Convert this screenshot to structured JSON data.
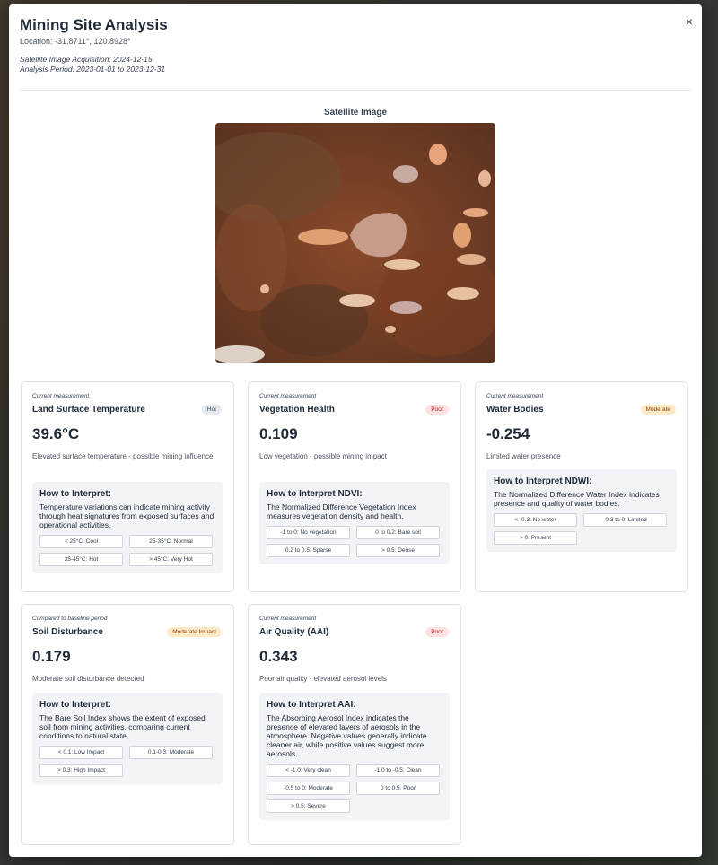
{
  "modal": {
    "title": "Mining Site Analysis",
    "location": "Location: -31.8711°, 120.8928°",
    "acquisition": "Satellite Image Acquisition: 2024-12-15",
    "period": "Analysis Period: 2023-01-01 to 2023-12-31",
    "close_label": "×",
    "image_title": "Satellite Image"
  },
  "cards": [
    {
      "subtitle": "Current measurement",
      "name": "Land Surface Temperature",
      "badge": "Hot",
      "value": "39.6°C",
      "desc": "Elevated surface temperature - possible mining influence",
      "interp_head": "How to Interpret:",
      "interp_text": "Temperature variations can indicate mining activity through heat signatures from exposed surfaces and operational activities.",
      "chips": [
        "< 25°C: Cool",
        "25-35°C: Normal",
        "35-45°C: Hot",
        "> 45°C: Very Hot"
      ]
    },
    {
      "subtitle": "Current measurement",
      "name": "Vegetation Health",
      "badge": "Poor",
      "value": "0.109",
      "desc": "Low vegetation - possible mining impact",
      "interp_head": "How to Interpret NDVI:",
      "interp_text": "The Normalized Difference Vegetation Index measures vegetation density and health.",
      "chips": [
        "-1 to 0: No vegetation",
        "0 to 0.2: Bare soil",
        "0.2 to 0.5: Sparse",
        "> 0.5: Dense"
      ]
    },
    {
      "subtitle": "Current measurement",
      "name": "Water Bodies",
      "badge": "Moderate",
      "value": "-0.254",
      "desc": "Limited water presence",
      "interp_head": "How to Interpret NDWI:",
      "interp_text": "The Normalized Difference Water Index indicates presence and quality of water bodies.",
      "chips": [
        "< -0.3: No water",
        "-0.3 to 0: Limited",
        "> 0: Present"
      ]
    },
    {
      "subtitle": "Compared to baseline period",
      "name": "Soil Disturbance",
      "badge": "Moderate Impact",
      "value": "0.179",
      "desc": "Moderate soil disturbance detected",
      "interp_head": "How to Interpret:",
      "interp_text": "The Bare Soil Index shows the extent of exposed soil from mining activities, comparing current conditions to natural state.",
      "chips": [
        "< 0.1: Low Impact",
        "0.1-0.3: Moderate",
        "> 0.3: High Impact"
      ]
    },
    {
      "subtitle": "Current measurement",
      "name": "Air Quality (AAI)",
      "badge": "Poor",
      "value": "0.343",
      "desc": "Poor air quality - elevated aerosol levels",
      "interp_head": "How to Interpret AAI:",
      "interp_text": "The Absorbing Aerosol Index indicates the presence of elevated layers of aerosols in the atmosphere. Negative values generally indicate cleaner air, while positive values suggest more aerosols.",
      "chips": [
        "< -1.0: Very clean",
        "-1.0 to -0.5: Clean",
        "-0.5 to 0: Moderate",
        "0 to 0.5: Poor",
        "> 0.5: Severe"
      ]
    }
  ]
}
